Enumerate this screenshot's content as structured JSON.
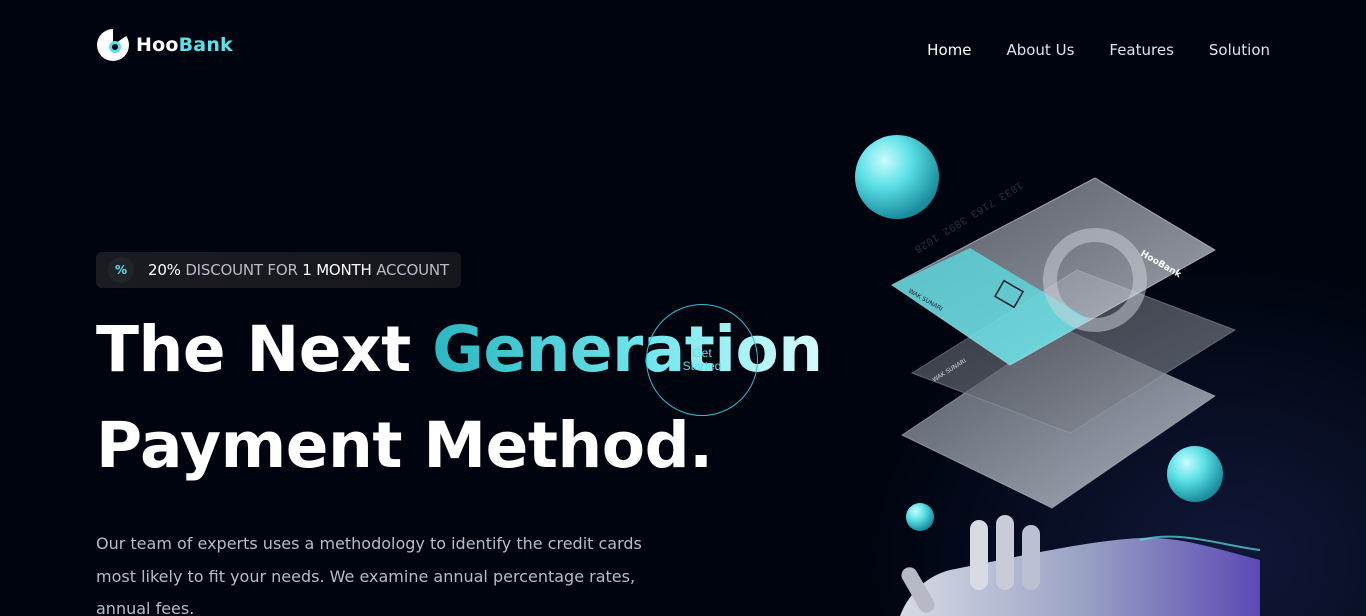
{
  "brand": {
    "name_part1": "Hoo",
    "name_part2": "Bank",
    "accent": "#5ce1e6",
    "background": "#00040f"
  },
  "nav": {
    "items": [
      {
        "label": "Home",
        "active": true
      },
      {
        "label": "About Us",
        "active": false
      },
      {
        "label": "Features",
        "active": false
      },
      {
        "label": "Solution",
        "active": false
      }
    ]
  },
  "badge": {
    "icon": "percent-icon",
    "percent": "20%",
    "text1": "DISCOUNT FOR",
    "duration": "1 MONTH",
    "text2": "ACCOUNT"
  },
  "hero": {
    "line1_plain": "The Next",
    "line1_accent": "Generation",
    "line2": "Payment Method.",
    "cta_label": "Get Started",
    "description": "Our team of experts uses a methodology to identify the credit cards most likely to fit your needs. We examine annual percentage rates, annual fees."
  },
  "card": {
    "number": "1833 7163 3892 1028",
    "holder": "WAK SUNARI",
    "expiry": "08/2024",
    "brand_label": "HooBank"
  }
}
